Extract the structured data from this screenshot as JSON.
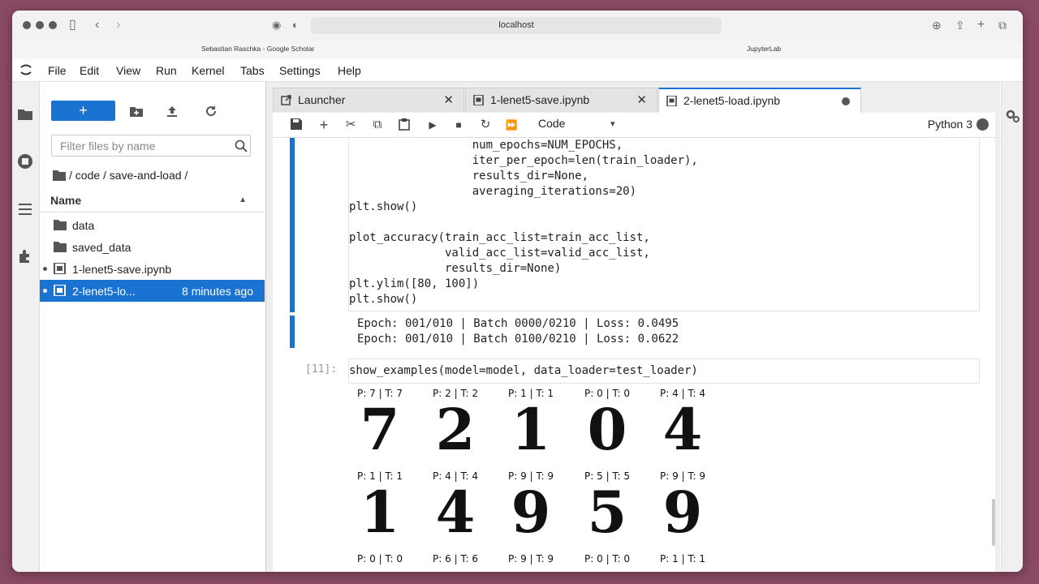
{
  "browser": {
    "url": "localhost",
    "bookmarks": [
      "Sebastian Raschka - Google Scholar",
      "JupyterLab"
    ]
  },
  "menu": [
    "File",
    "Edit",
    "View",
    "Run",
    "Kernel",
    "Tabs",
    "Settings",
    "Help"
  ],
  "filebrowser": {
    "new_label": "+",
    "filter_placeholder": "Filter files by name",
    "breadcrumb": "/ code / save-and-load /",
    "column_name": "Name",
    "items": [
      {
        "name": "data",
        "type": "folder",
        "modified": ""
      },
      {
        "name": "saved_data",
        "type": "folder",
        "modified": ""
      },
      {
        "name": "1-lenet5-save.ipynb",
        "type": "notebook",
        "modified": ""
      },
      {
        "name": "2-lenet5-lo...",
        "type": "notebook",
        "modified": "8 minutes ago"
      }
    ]
  },
  "tabs": [
    {
      "label": "Launcher"
    },
    {
      "label": "1-lenet5-save.ipynb"
    },
    {
      "label": "2-lenet5-load.ipynb"
    }
  ],
  "toolbar": {
    "cell_type": "Code",
    "kernel": "Python 3"
  },
  "cells": {
    "code1": "                  num_epochs=NUM_EPOCHS,\n                  iter_per_epoch=len(train_loader),\n                  results_dir=None,\n                  averaging_iterations=20)\nplt.show()\n\nplot_accuracy(train_acc_list=train_acc_list,\n              valid_acc_list=valid_acc_list,\n              results_dir=None)\nplt.ylim([80, 100])\nplt.show()",
    "output1": "Epoch: 001/010 | Batch 0000/0210 | Loss: 0.0495\nEpoch: 001/010 | Batch 0100/0210 | Loss: 0.0622",
    "prompt2": "[11]:",
    "code2": "show_examples(model=model, data_loader=test_loader)"
  },
  "examples": [
    {
      "caption": "P: 7 | T: 7",
      "digit": "7"
    },
    {
      "caption": "P: 2 | T: 2",
      "digit": "2"
    },
    {
      "caption": "P: 1 | T: 1",
      "digit": "1"
    },
    {
      "caption": "P: 0 | T: 0",
      "digit": "0"
    },
    {
      "caption": "P: 4 | T: 4",
      "digit": "4"
    },
    {
      "caption": "P: 1 | T: 1",
      "digit": "1"
    },
    {
      "caption": "P: 4 | T: 4",
      "digit": "4"
    },
    {
      "caption": "P: 9 | T: 9",
      "digit": "9"
    },
    {
      "caption": "P: 5 | T: 5",
      "digit": "5"
    },
    {
      "caption": "P: 9 | T: 9",
      "digit": "9"
    },
    {
      "caption": "P: 0 | T: 0",
      "digit": ""
    },
    {
      "caption": "P: 6 | T: 6",
      "digit": ""
    },
    {
      "caption": "P: 9 | T: 9",
      "digit": ""
    },
    {
      "caption": "P: 0 | T: 0",
      "digit": ""
    },
    {
      "caption": "P: 1 | T: 1",
      "digit": ""
    }
  ],
  "colors": {
    "accent": "#1a73d1",
    "selected_row": "#1a73d1"
  }
}
